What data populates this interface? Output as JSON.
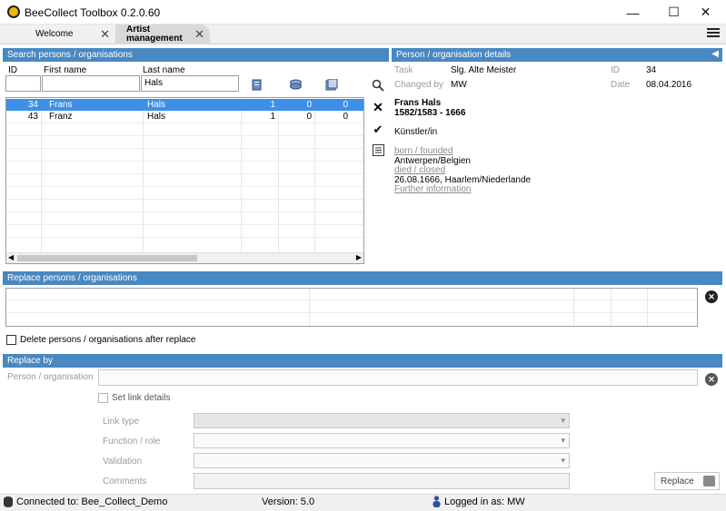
{
  "window": {
    "title": "BeeCollect Toolbox 0.2.0.60",
    "minimize": "—",
    "maximize": "☐",
    "close": "✕"
  },
  "tabs": [
    {
      "label": "Welcome",
      "close": "✕"
    },
    {
      "label_line1": "Artist",
      "label_line2": "management",
      "close": "✕"
    }
  ],
  "search": {
    "header": "Search persons / organisations",
    "id_label": "ID",
    "first_name_label": "First name",
    "last_name_label": "Last name",
    "id_value": "",
    "first_name_value": "",
    "last_name_value": "Hals",
    "rows": [
      {
        "id": "34",
        "first": "Frans",
        "last": "Hals",
        "c1": "1",
        "c2": "0",
        "c3": "0",
        "selected": true
      },
      {
        "id": "43",
        "first": "Franz",
        "last": "Hals",
        "c1": "1",
        "c2": "0",
        "c3": "0",
        "selected": false
      }
    ]
  },
  "details": {
    "header": "Person / organisation details",
    "task_label": "Task",
    "task_value": "Slg. Alte Meister",
    "changed_by_label": "Changed by",
    "changed_by_value": "MW",
    "id_label": "ID",
    "id_value": "34",
    "date_label": "Date",
    "date_value": "08.04.2016",
    "name": "Frans Hals",
    "years": "1582/1583 - 1666",
    "role": "Künstler/in",
    "born_link": "born / founded",
    "born_place": "Antwerpen/Belgien",
    "died_link": "died / closed",
    "died_info": "26.08.1666, Haarlem/Niederlande",
    "further_link": "Further information"
  },
  "replace": {
    "header": "Replace persons / organisations",
    "delete_checkbox_label": "Delete persons / organisations after replace",
    "delete_checked": false
  },
  "replace_by": {
    "header": "Replace by",
    "person_label": "Person / organisation",
    "person_value": "",
    "set_link_label": "Set link details",
    "link_type_label": "Link type",
    "function_label": "Function / role",
    "validation_label": "Validation",
    "comments_label": "Comments",
    "replace_button": "Replace"
  },
  "status": {
    "connected": "Connected to: Bee_Collect_Demo",
    "version": "Version: 5.0",
    "logged_in": "Logged in as: MW"
  }
}
